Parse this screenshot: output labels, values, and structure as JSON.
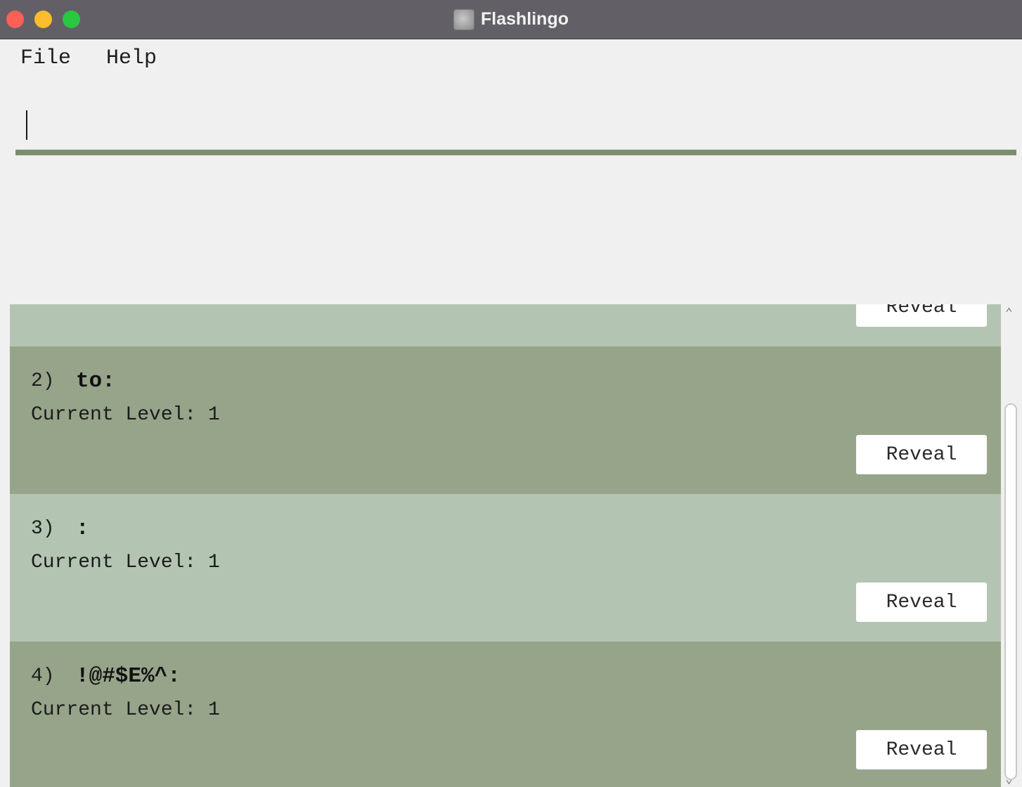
{
  "window": {
    "title": "Flashlingo",
    "icon": "app-icon"
  },
  "menu": {
    "file": "File",
    "help": "Help"
  },
  "command": {
    "value": "",
    "placeholder": ""
  },
  "result": {
    "text": ""
  },
  "cards": [
    {
      "index": "",
      "word": "",
      "level": "",
      "reveal": "Reveal"
    },
    {
      "index": "2)",
      "word": "to:",
      "level": "Current Level: 1",
      "reveal": "Reveal"
    },
    {
      "index": "3)",
      "word": ":",
      "level": "Current Level: 1",
      "reveal": "Reveal"
    },
    {
      "index": "4)",
      "word": "!@#$E%^:",
      "level": "Current Level: 1",
      "reveal": "Reveal"
    }
  ],
  "colors": {
    "card_light": "#b3c5b2",
    "card_dark": "#96a48a",
    "accent": "#7b8f6f",
    "titlebar": "#626066"
  },
  "scrollbar": {
    "up_icon": "chevron-up-icon",
    "down_icon": "chevron-down-icon"
  }
}
